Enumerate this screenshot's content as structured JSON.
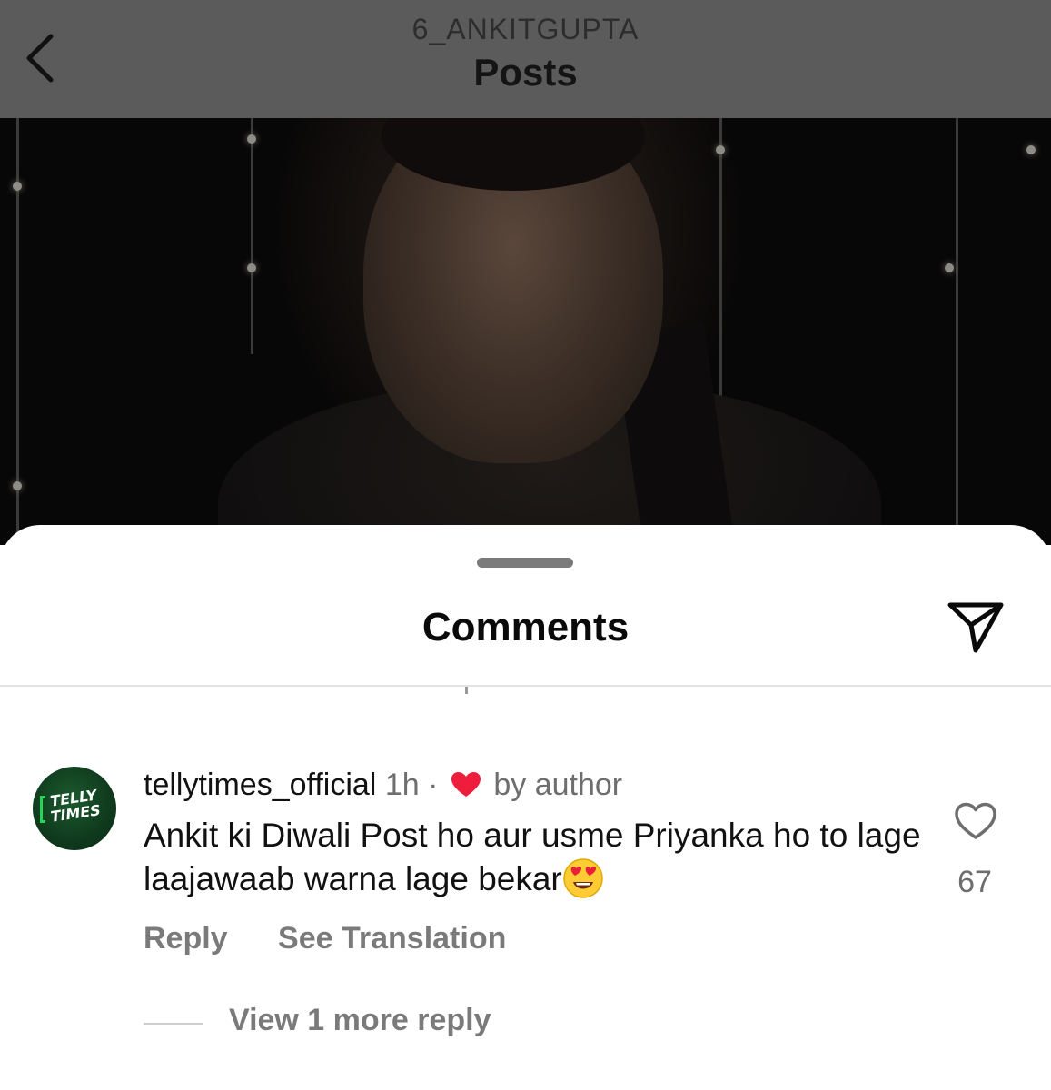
{
  "header": {
    "account": "6_ANKITGUPTA",
    "title": "Posts",
    "back_icon": "chevron-left-icon"
  },
  "post": {
    "image": "post-photo"
  },
  "comments_sheet": {
    "title": "Comments",
    "share_icon": "paper-plane-icon",
    "comment": {
      "username": "tellytimes_official",
      "time": "1h",
      "separator": "·",
      "author_like_label": "by author",
      "avatar_logo_line1": "TELLY",
      "avatar_logo_line2": "TIMES",
      "text": "Ankit ki Diwali Post ho aur usme Priyanka ho to lage laajawaab warna lage bekar",
      "emoji": "😍",
      "like_count": "67",
      "reply_label": "Reply",
      "translate_label": "See Translation",
      "view_replies_label": "View 1 more reply"
    }
  },
  "colors": {
    "heart_red": "#ee1d3c",
    "avatar_green": "#0f3a1d",
    "muted_text": "#6e6e6e"
  }
}
